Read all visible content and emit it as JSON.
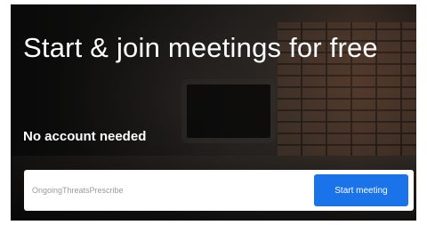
{
  "hero": {
    "headline": "Start & join meetings for free",
    "subhead": "No account needed"
  },
  "join": {
    "room_placeholder": "OngoingThreatsPrescribe",
    "room_value": "",
    "start_button_label": "Start meeting"
  },
  "colors": {
    "accent": "#1a73e8",
    "text_on_dark": "#ffffff",
    "input_background": "#ffffff"
  }
}
